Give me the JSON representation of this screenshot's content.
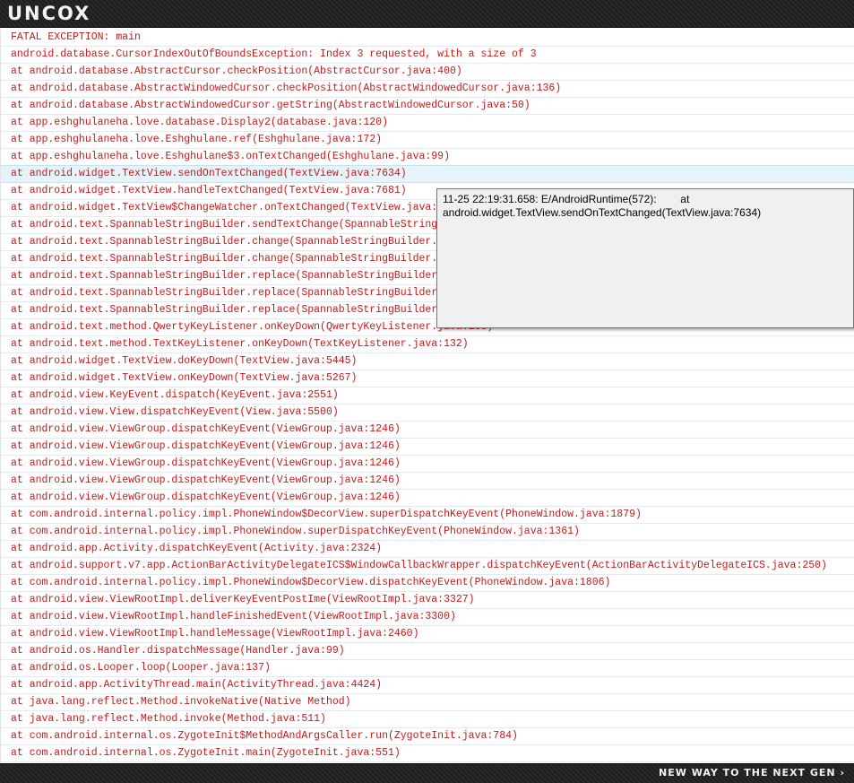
{
  "header": {
    "logo": "UNCOX"
  },
  "log": {
    "lines": [
      "FATAL EXCEPTION: main",
      "android.database.CursorIndexOutOfBoundsException: Index 3 requested, with a size of 3",
      "at android.database.AbstractCursor.checkPosition(AbstractCursor.java:400)",
      "at android.database.AbstractWindowedCursor.checkPosition(AbstractWindowedCursor.java:136)",
      "at android.database.AbstractWindowedCursor.getString(AbstractWindowedCursor.java:50)",
      "at app.eshghulaneha.love.database.Display2(database.java:120)",
      "at app.eshghulaneha.love.Eshghulane.ref(Eshghulane.java:172)",
      "at app.eshghulaneha.love.Eshghulane$3.onTextChanged(Eshghulane.java:99)",
      "at android.widget.TextView.sendOnTextChanged(TextView.java:7634)",
      "at android.widget.TextView.handleTextChanged(TextView.java:7681)",
      "at android.widget.TextView$ChangeWatcher.onTextChanged(TextView.java:9440)",
      "at android.text.SpannableStringBuilder.sendTextChange(SpannableStringBuilder.java:962)",
      "at android.text.SpannableStringBuilder.change(SpannableStringBuilder.java:496)",
      "at android.text.SpannableStringBuilder.change(SpannableStringBuilder.java:435)",
      "at android.text.SpannableStringBuilder.replace(SpannableStringBuilder.java:409)",
      "at android.text.SpannableStringBuilder.replace(SpannableStringBuilder.java:28)",
      "at android.text.SpannableStringBuilder.replace(SpannableStringBuilder.java:28)",
      "at android.text.method.QwertyKeyListener.onKeyDown(QwertyKeyListener.java:188)",
      "at android.text.method.TextKeyListener.onKeyDown(TextKeyListener.java:132)",
      "at android.widget.TextView.doKeyDown(TextView.java:5445)",
      "at android.widget.TextView.onKeyDown(TextView.java:5267)",
      "at android.view.KeyEvent.dispatch(KeyEvent.java:2551)",
      "at android.view.View.dispatchKeyEvent(View.java:5500)",
      "at android.view.ViewGroup.dispatchKeyEvent(ViewGroup.java:1246)",
      "at android.view.ViewGroup.dispatchKeyEvent(ViewGroup.java:1246)",
      "at android.view.ViewGroup.dispatchKeyEvent(ViewGroup.java:1246)",
      "at android.view.ViewGroup.dispatchKeyEvent(ViewGroup.java:1246)",
      "at android.view.ViewGroup.dispatchKeyEvent(ViewGroup.java:1246)",
      "at com.android.internal.policy.impl.PhoneWindow$DecorView.superDispatchKeyEvent(PhoneWindow.java:1879)",
      "at com.android.internal.policy.impl.PhoneWindow.superDispatchKeyEvent(PhoneWindow.java:1361)",
      "at android.app.Activity.dispatchKeyEvent(Activity.java:2324)",
      "at android.support.v7.app.ActionBarActivityDelegateICS$WindowCallbackWrapper.dispatchKeyEvent(ActionBarActivityDelegateICS.java:250)",
      "at com.android.internal.policy.impl.PhoneWindow$DecorView.dispatchKeyEvent(PhoneWindow.java:1806)",
      "at android.view.ViewRootImpl.deliverKeyEventPostIme(ViewRootImpl.java:3327)",
      "at android.view.ViewRootImpl.handleFinishedEvent(ViewRootImpl.java:3300)",
      "at android.view.ViewRootImpl.handleMessage(ViewRootImpl.java:2460)",
      "at android.os.Handler.dispatchMessage(Handler.java:99)",
      "at android.os.Looper.loop(Looper.java:137)",
      "at android.app.ActivityThread.main(ActivityThread.java:4424)",
      "at java.lang.reflect.Method.invokeNative(Native Method)",
      "at java.lang.reflect.Method.invoke(Method.java:511)",
      "at com.android.internal.os.ZygoteInit$MethodAndArgsCaller.run(ZygoteInit.java:784)",
      "at com.android.internal.os.ZygoteInit.main(ZygoteInit.java:551)"
    ],
    "selected_index": 8
  },
  "tooltip": {
    "line1": "11-25 22:19:31.658: E/AndroidRuntime(572):        at",
    "line2": "android.widget.TextView.sendOnTextChanged(TextView.java:7634)"
  },
  "footer": {
    "tagline": "NEW WAY TO THE NEXT GEN ›"
  },
  "colors": {
    "error_text": "#c41a1a",
    "selected_row": "#e5f3fb",
    "tooltip_bg": "#f0f0f0"
  }
}
